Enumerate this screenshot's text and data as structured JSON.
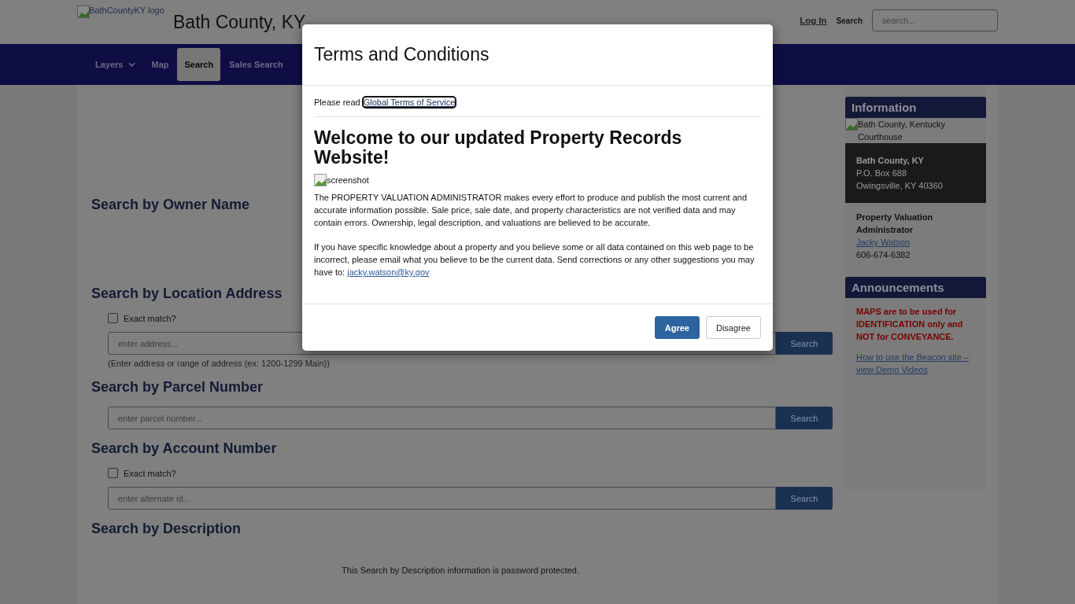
{
  "header": {
    "logo_alt": "BathCountyKY logo",
    "site_title": "Bath County, KY",
    "login_link": "Log In",
    "search_label": "Search",
    "search_placeholder": "search..."
  },
  "nav": [
    {
      "label": "Layers",
      "dropdown": true,
      "selected": false
    },
    {
      "label": "Map",
      "dropdown": false,
      "selected": false
    },
    {
      "label": "Search",
      "dropdown": false,
      "selected": true
    },
    {
      "label": "Sales Search",
      "dropdown": false,
      "selected": false
    }
  ],
  "sections": [
    {
      "heading": "Search by Owner Name"
    },
    {
      "heading": "Search by Location Address",
      "exact_match": {
        "label": "Exact match?",
        "checked": false
      },
      "field": {
        "placeholder": "enter address...",
        "button": "Search"
      },
      "hint": "(Enter address or range of address (ex: 1200-1299 Main))"
    },
    {
      "heading": "Search by Parcel Number",
      "field": {
        "placeholder": "enter parcel number...",
        "button": "Search"
      }
    },
    {
      "heading": "Search by Account Number",
      "exact_match": {
        "label": "Exact match?",
        "checked": false
      },
      "field": {
        "placeholder": "enter alternate id...",
        "button": "Search"
      }
    },
    {
      "heading": "Search by Description",
      "note": "This Search by Description information is password protected."
    }
  ],
  "sidebar": {
    "information": {
      "heading": "Information",
      "image_alt": "Bath County, Kentucky Courthouse",
      "address_name": "Bath County, KY",
      "address_lines": [
        "P.O. Box 688",
        "Owingsville, KY 40360"
      ],
      "role": "Property Valuation Administrator",
      "contact_link": "Jacky Watson",
      "phone": "606-674-6382"
    },
    "announcements": {
      "heading": "Announcements",
      "warning": "MAPS are to be used for IDENTIFICATION only and NOT for CONVEYANCE.",
      "link": "How to use the Beacon site – view Demo Videos"
    }
  },
  "modal": {
    "title": "Terms and Conditions",
    "read_text": "Please read",
    "terms_link": "Global Terms of Service",
    "heading": "Welcome to our updated Property Records Website!",
    "image_alt": "screenshot",
    "paragraph": "The PROPERTY VALUATION ADMINISTRATOR makes every effort to produce and publish the most current and accurate information possible. Sale price, sale date, and property characteristics are not verified data and may contain errors. Ownership, legal description, and valuations are believed to be accurate.",
    "contact_text": "If you have specific knowledge about a property and you believe some or all data contained on this web page to be incorrect, please email what you believe to be the current data. Send corrections or any other suggestions you may have to:",
    "contact_email": "jacky.watson@ky.gov",
    "buttons": [
      {
        "label": "Agree",
        "kind": "primary"
      },
      {
        "label": "Disagree",
        "kind": "secondary"
      }
    ]
  }
}
